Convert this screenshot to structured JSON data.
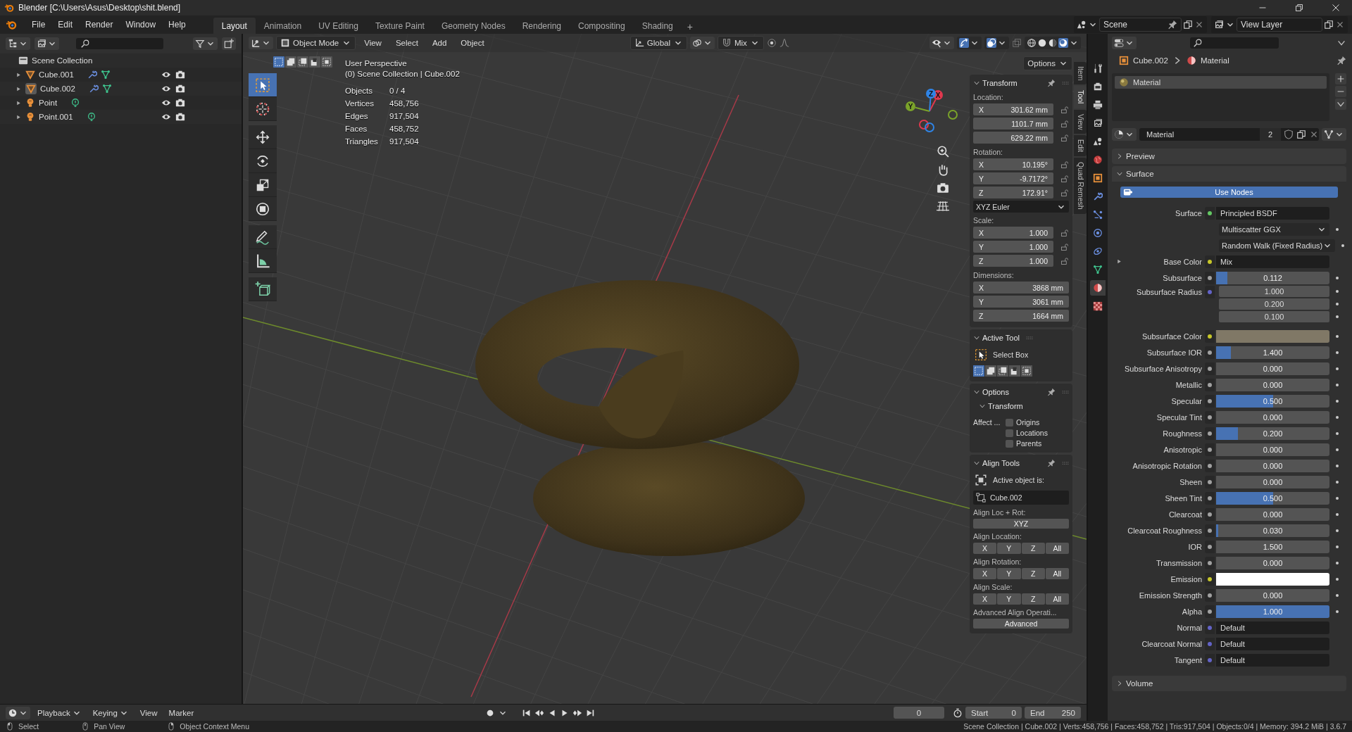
{
  "window": {
    "title": "Blender [C:\\Users\\Asus\\Desktop\\shit.blend]"
  },
  "menu": [
    "File",
    "Edit",
    "Render",
    "Window",
    "Help"
  ],
  "workspaces": [
    {
      "label": "Layout",
      "selected": true
    },
    {
      "label": "Animation",
      "selected": false
    },
    {
      "label": "UV Editing",
      "selected": false
    },
    {
      "label": "Texture Paint",
      "selected": false
    },
    {
      "label": "Geometry Nodes",
      "selected": false
    },
    {
      "label": "Rendering",
      "selected": false
    },
    {
      "label": "Compositing",
      "selected": false
    },
    {
      "label": "Shading",
      "selected": false
    }
  ],
  "add_workspace": "+",
  "scene": "Scene",
  "view_layer": "View Layer",
  "outliner": {
    "root": "Scene Collection",
    "items": [
      {
        "name": "Cube.001",
        "kind": "mesh",
        "active": false
      },
      {
        "name": "Cube.002",
        "kind": "mesh",
        "active": true
      },
      {
        "name": "Point",
        "kind": "light",
        "active": false
      },
      {
        "name": "Point.001",
        "kind": "light",
        "active": false
      }
    ]
  },
  "viewport": {
    "mode": "Object Mode",
    "menus": [
      "View",
      "Select",
      "Add",
      "Object"
    ],
    "orientation": "Global",
    "snap_target": "Mix",
    "options": "Options",
    "select_modes": [
      {
        "selected": true
      },
      {
        "selected": false
      },
      {
        "selected": false
      },
      {
        "selected": false
      },
      {
        "selected": false
      }
    ],
    "perspective": "User Perspective",
    "context": "(0) Scene Collection | Cube.002",
    "stats": [
      {
        "label": "Objects",
        "value": "0 / 4"
      },
      {
        "label": "Vertices",
        "value": "458,756"
      },
      {
        "label": "Edges",
        "value": "917,504"
      },
      {
        "label": "Faces",
        "value": "458,752"
      },
      {
        "label": "Triangles",
        "value": "917,504"
      }
    ],
    "tools": [
      {
        "kind": "select",
        "selected": true
      },
      {
        "kind": "cursor",
        "selected": false
      },
      {
        "kind": "move",
        "selected": false
      },
      {
        "kind": "rotate",
        "selected": false
      },
      {
        "kind": "scale",
        "selected": false
      },
      {
        "kind": "transform",
        "selected": false
      },
      {
        "kind": "annotate",
        "selected": false
      },
      {
        "kind": "measure",
        "selected": false
      },
      {
        "kind": "add-cube",
        "selected": false
      }
    ],
    "axes": [
      {
        "label": "X",
        "color": "#e0384e"
      },
      {
        "label": "Y",
        "color": "#7ba32a"
      },
      {
        "label": "Z",
        "color": "#2f84e6"
      }
    ],
    "shading_modes": [
      {
        "selected": false
      },
      {
        "selected": false
      },
      {
        "selected": false
      },
      {
        "selected": true
      }
    ]
  },
  "sidebar": {
    "tabs": [
      {
        "label": "Item",
        "selected": false
      },
      {
        "label": "Tool",
        "selected": true
      },
      {
        "label": "View",
        "selected": false
      },
      {
        "label": "Edit",
        "selected": false
      },
      {
        "label": "Quad Remesh",
        "selected": false
      }
    ],
    "transform": {
      "title": "Transform",
      "groups": [
        {
          "label": "Location:",
          "locks": true,
          "fields": [
            {
              "axis": "X",
              "value": "301.62 mm"
            },
            {
              "value": "1101.7 mm"
            },
            {
              "value": "629.22 mm"
            }
          ]
        },
        {
          "label": "Rotation:",
          "locks": true,
          "fields": [
            {
              "axis": "X",
              "value": "10.195°"
            },
            {
              "axis": "Y",
              "value": "-9.7172°"
            },
            {
              "axis": "Z",
              "value": "172.91°"
            }
          ],
          "mode": "XYZ Euler"
        },
        {
          "label": "Scale:",
          "locks": true,
          "fields": [
            {
              "axis": "X",
              "value": "1.000"
            },
            {
              "axis": "Y",
              "value": "1.000"
            },
            {
              "axis": "Z",
              "value": "1.000"
            }
          ]
        },
        {
          "label": "Dimensions:",
          "locks": false,
          "fields": [
            {
              "axis": "X",
              "value": "3868 mm"
            },
            {
              "axis": "Y",
              "value": "3061 mm"
            },
            {
              "axis": "Z",
              "value": "1664 mm"
            }
          ]
        }
      ]
    },
    "active_tool": {
      "title": "Active Tool",
      "tool": "Select Box",
      "modes": [
        {
          "selected": true
        },
        {
          "selected": false
        },
        {
          "selected": false
        },
        {
          "selected": false
        },
        {
          "selected": false
        }
      ]
    },
    "options": {
      "title": "Options",
      "section": "Transform",
      "affect": "Affect ...",
      "checks": [
        {
          "label": "Origins",
          "checked": false
        },
        {
          "label": "Locations",
          "checked": false
        },
        {
          "label": "Parents",
          "checked": false
        }
      ]
    },
    "align_tools": {
      "title": "Align Tools",
      "active_label": "Active object is:",
      "active_object": "Cube.002",
      "loc_rot_label": "Align Loc + Rot:",
      "loc_rot_button": "XYZ",
      "groups": [
        {
          "label": "Align Location:",
          "buttons": [
            "X",
            "Y",
            "Z",
            "All"
          ]
        },
        {
          "label": "Align Rotation:",
          "buttons": [
            "X",
            "Y",
            "Z",
            "All"
          ]
        },
        {
          "label": "Align Scale:",
          "buttons": [
            "X",
            "Y",
            "Z",
            "All"
          ]
        }
      ],
      "advanced_label": "Advanced Align Operati...",
      "advanced_button": "Advanced"
    }
  },
  "properties": {
    "tabs": [
      {
        "kind": "tool",
        "selected": false
      },
      {
        "kind": "render",
        "selected": false
      },
      {
        "kind": "output",
        "selected": false
      },
      {
        "kind": "view-layer",
        "selected": false
      },
      {
        "kind": "scene",
        "selected": false
      },
      {
        "kind": "world",
        "selected": false
      },
      {
        "kind": "object",
        "selected": false
      },
      {
        "kind": "modifier",
        "selected": false
      },
      {
        "kind": "particles",
        "selected": false
      },
      {
        "kind": "physics",
        "selected": false
      },
      {
        "kind": "constraint",
        "selected": false
      },
      {
        "kind": "data",
        "selected": false
      },
      {
        "kind": "material",
        "selected": true
      },
      {
        "kind": "texture",
        "selected": false
      }
    ],
    "breadcrumb": [
      "Cube.002",
      "Material"
    ],
    "slots": [
      {
        "name": "Material",
        "selected": true
      }
    ],
    "material": {
      "name": "Material",
      "users": "2"
    },
    "preview": {
      "title": "Preview",
      "expanded": false
    },
    "surface": {
      "title": "Surface",
      "expanded": true,
      "use_nodes": "Use Nodes",
      "rows": [
        {
          "kind": "socket",
          "label": "Surface",
          "color": "#63c763",
          "value": "Principled BSDF"
        },
        {
          "kind": "dropdown",
          "value": "Multiscatter GGX"
        },
        {
          "kind": "dropdown",
          "value": "Random Walk (Fixed Radius)"
        },
        {
          "kind": "linked",
          "label": "Base Color",
          "color": "#c7c729",
          "value": "Mix"
        },
        {
          "kind": "slider",
          "label": "Subsurface",
          "color": "#a1a1a1",
          "value": "0.112",
          "level": 0.1
        },
        {
          "kind": "vector",
          "label": "Subsurface Radius",
          "color": "#6363c7",
          "values": [
            "1.000",
            "0.200",
            "0.100"
          ]
        },
        {
          "kind": "color",
          "label": "Subsurface Color",
          "color": "#c7c729",
          "swatch": {
            "color": "#807866"
          }
        },
        {
          "kind": "slider",
          "label": "Subsurface IOR",
          "color": "#a1a1a1",
          "value": "1.400",
          "level": 0.13
        },
        {
          "kind": "slider",
          "label": "Subsurface Anisotropy",
          "color": "#a1a1a1",
          "value": "0.000",
          "level": 0
        },
        {
          "kind": "slider",
          "label": "Metallic",
          "color": "#a1a1a1",
          "value": "0.000",
          "level": 0
        },
        {
          "kind": "slider",
          "label": "Specular",
          "color": "#a1a1a1",
          "value": "0.500",
          "level": 0.5
        },
        {
          "kind": "slider",
          "label": "Specular Tint",
          "color": "#a1a1a1",
          "value": "0.000",
          "level": 0
        },
        {
          "kind": "slider",
          "label": "Roughness",
          "color": "#a1a1a1",
          "value": "0.200",
          "level": 0.19
        },
        {
          "kind": "slider",
          "label": "Anisotropic",
          "color": "#a1a1a1",
          "value": "0.000",
          "level": 0
        },
        {
          "kind": "slider",
          "label": "Anisotropic Rotation",
          "color": "#a1a1a1",
          "value": "0.000",
          "level": 0
        },
        {
          "kind": "slider",
          "label": "Sheen",
          "color": "#a1a1a1",
          "value": "0.000",
          "level": 0
        },
        {
          "kind": "slider",
          "label": "Sheen Tint",
          "color": "#a1a1a1",
          "value": "0.500",
          "level": 0.5
        },
        {
          "kind": "slider",
          "label": "Clearcoat",
          "color": "#a1a1a1",
          "value": "0.000",
          "level": 0
        },
        {
          "kind": "slider",
          "label": "Clearcoat Roughness",
          "color": "#a1a1a1",
          "value": "0.030",
          "level": 0.02
        },
        {
          "kind": "slider",
          "label": "IOR",
          "color": "#a1a1a1",
          "value": "1.500",
          "level": 0
        },
        {
          "kind": "slider",
          "label": "Transmission",
          "color": "#a1a1a1",
          "value": "0.000",
          "level": 0
        },
        {
          "kind": "color",
          "label": "Emission",
          "color": "#c7c729",
          "swatch": {
            "color": "#ffffff"
          }
        },
        {
          "kind": "slider",
          "label": "Emission Strength",
          "color": "#a1a1a1",
          "value": "0.000",
          "level": 0
        },
        {
          "kind": "slider",
          "label": "Alpha",
          "color": "#a1a1a1",
          "value": "1.000",
          "level": 1
        },
        {
          "kind": "socket",
          "label": "Normal",
          "color": "#6363c7",
          "value": "Default"
        },
        {
          "kind": "socket",
          "label": "Clearcoat Normal",
          "color": "#6363c7",
          "value": "Default"
        },
        {
          "kind": "socket",
          "label": "Tangent",
          "color": "#6363c7",
          "value": "Default"
        }
      ]
    },
    "volume": {
      "title": "Volume",
      "expanded": false
    }
  },
  "timeline": {
    "menus": [
      {
        "label": "Playback",
        "dropdown": true
      },
      {
        "label": "Keying",
        "dropdown": true
      },
      {
        "label": "View",
        "dropdown": false
      },
      {
        "label": "Marker",
        "dropdown": false
      }
    ],
    "frame": "0",
    "start_label": "Start",
    "start": "0",
    "end_label": "End",
    "end": "250"
  },
  "status_bar": {
    "hints": [
      {
        "kind": "left",
        "label": "Select"
      },
      {
        "kind": "middle",
        "label": "Pan View"
      },
      {
        "kind": "right",
        "label": "Object Context Menu"
      }
    ],
    "stats": "Scene Collection | Cube.002 | Verts:458,756 | Faces:458,752 | Tris:917,504 | Objects:0/4 | Memory: 394.2 MiB | 3.6.7"
  }
}
